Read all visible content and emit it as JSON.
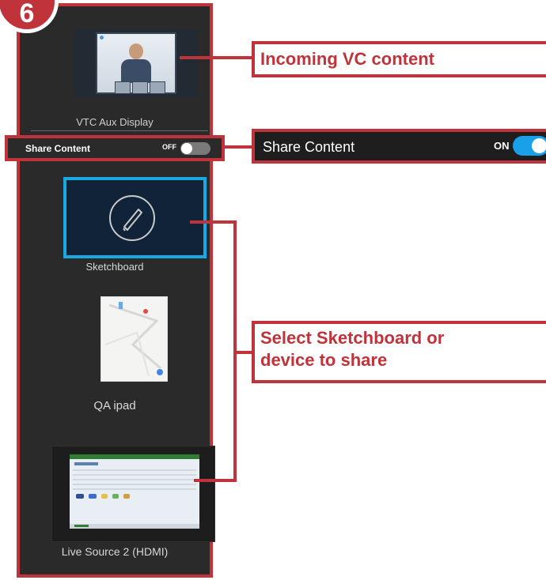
{
  "badge": {
    "number": "6"
  },
  "panel": {
    "vtc_label": "VTC Aux Display",
    "share_content_label": "Share Content",
    "share_toggle_state": "OFF",
    "sketchboard_label": "Sketchboard",
    "ipad_label": "QA ipad",
    "hdmi_label": "Live Source 2 (HDMI)"
  },
  "callouts": {
    "incoming": "Incoming VC content",
    "share_label": "Share Content",
    "share_state": "ON",
    "select_line1": "Select Sketchboard or",
    "select_line2": "device to share"
  },
  "colors": {
    "accent_red": "#c0333a",
    "panel_bg": "#2a2a2a",
    "selection_blue": "#19a9e0",
    "toggle_on": "#1aa0e8"
  },
  "icons": [
    "pencil-icon",
    "toggle-switch"
  ]
}
